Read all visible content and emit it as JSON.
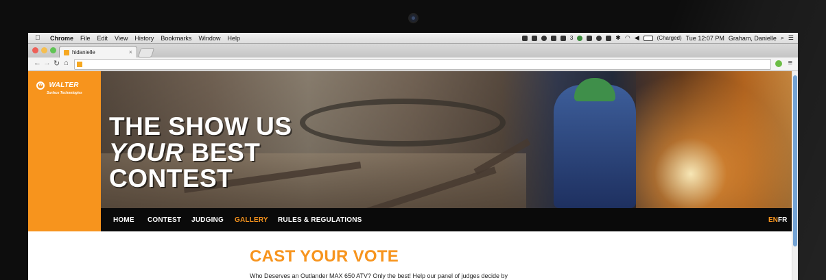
{
  "menubar": {
    "items": [
      "Chrome",
      "File",
      "Edit",
      "View",
      "History",
      "Bookmarks",
      "Window",
      "Help"
    ],
    "badge_count": "3",
    "battery": "(Charged)",
    "clock": "Tue 12:07 PM",
    "user": "Graham, Danielle"
  },
  "browser": {
    "tab_title": "hidanielle",
    "tab_close": "×",
    "url": ""
  },
  "site": {
    "logo_brand": "WALTER",
    "logo_sub": "Surface Technologies",
    "hero_line1": "THE SHOW US",
    "hero_line2_em": "YOUR",
    "hero_line2_rest": " BEST",
    "hero_line3": "CONTEST",
    "nav": [
      "HOME",
      "CONTEST",
      "JUDGING",
      "GALLERY",
      "RULES & REGULATIONS"
    ],
    "nav_active": "GALLERY",
    "lang_en": "EN",
    "lang_fr": "FR",
    "vote_title": "CAST YOUR VOTE",
    "vote_text": "Who Deserves an Outlander MAX 650 ATV? Only the best! Help our panel of judges decide by"
  },
  "colors": {
    "accent_orange": "#f7941d",
    "nav_bg": "#0a0a0a"
  }
}
